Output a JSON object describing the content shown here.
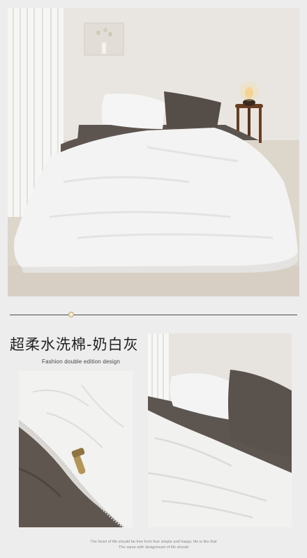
{
  "product": {
    "title": "超柔水洗棉-奶白灰",
    "subtitle": "Fashion double edition design"
  },
  "footer": {
    "line1": "The heart of life should be free from fear simple and happy. life is like that",
    "line2": "The same with designheart of life should"
  },
  "colors": {
    "background": "#eeeded",
    "accent_gold": "#c9a44b",
    "gray_brown": "#5a524c",
    "milk_white": "#f3f3f3"
  }
}
